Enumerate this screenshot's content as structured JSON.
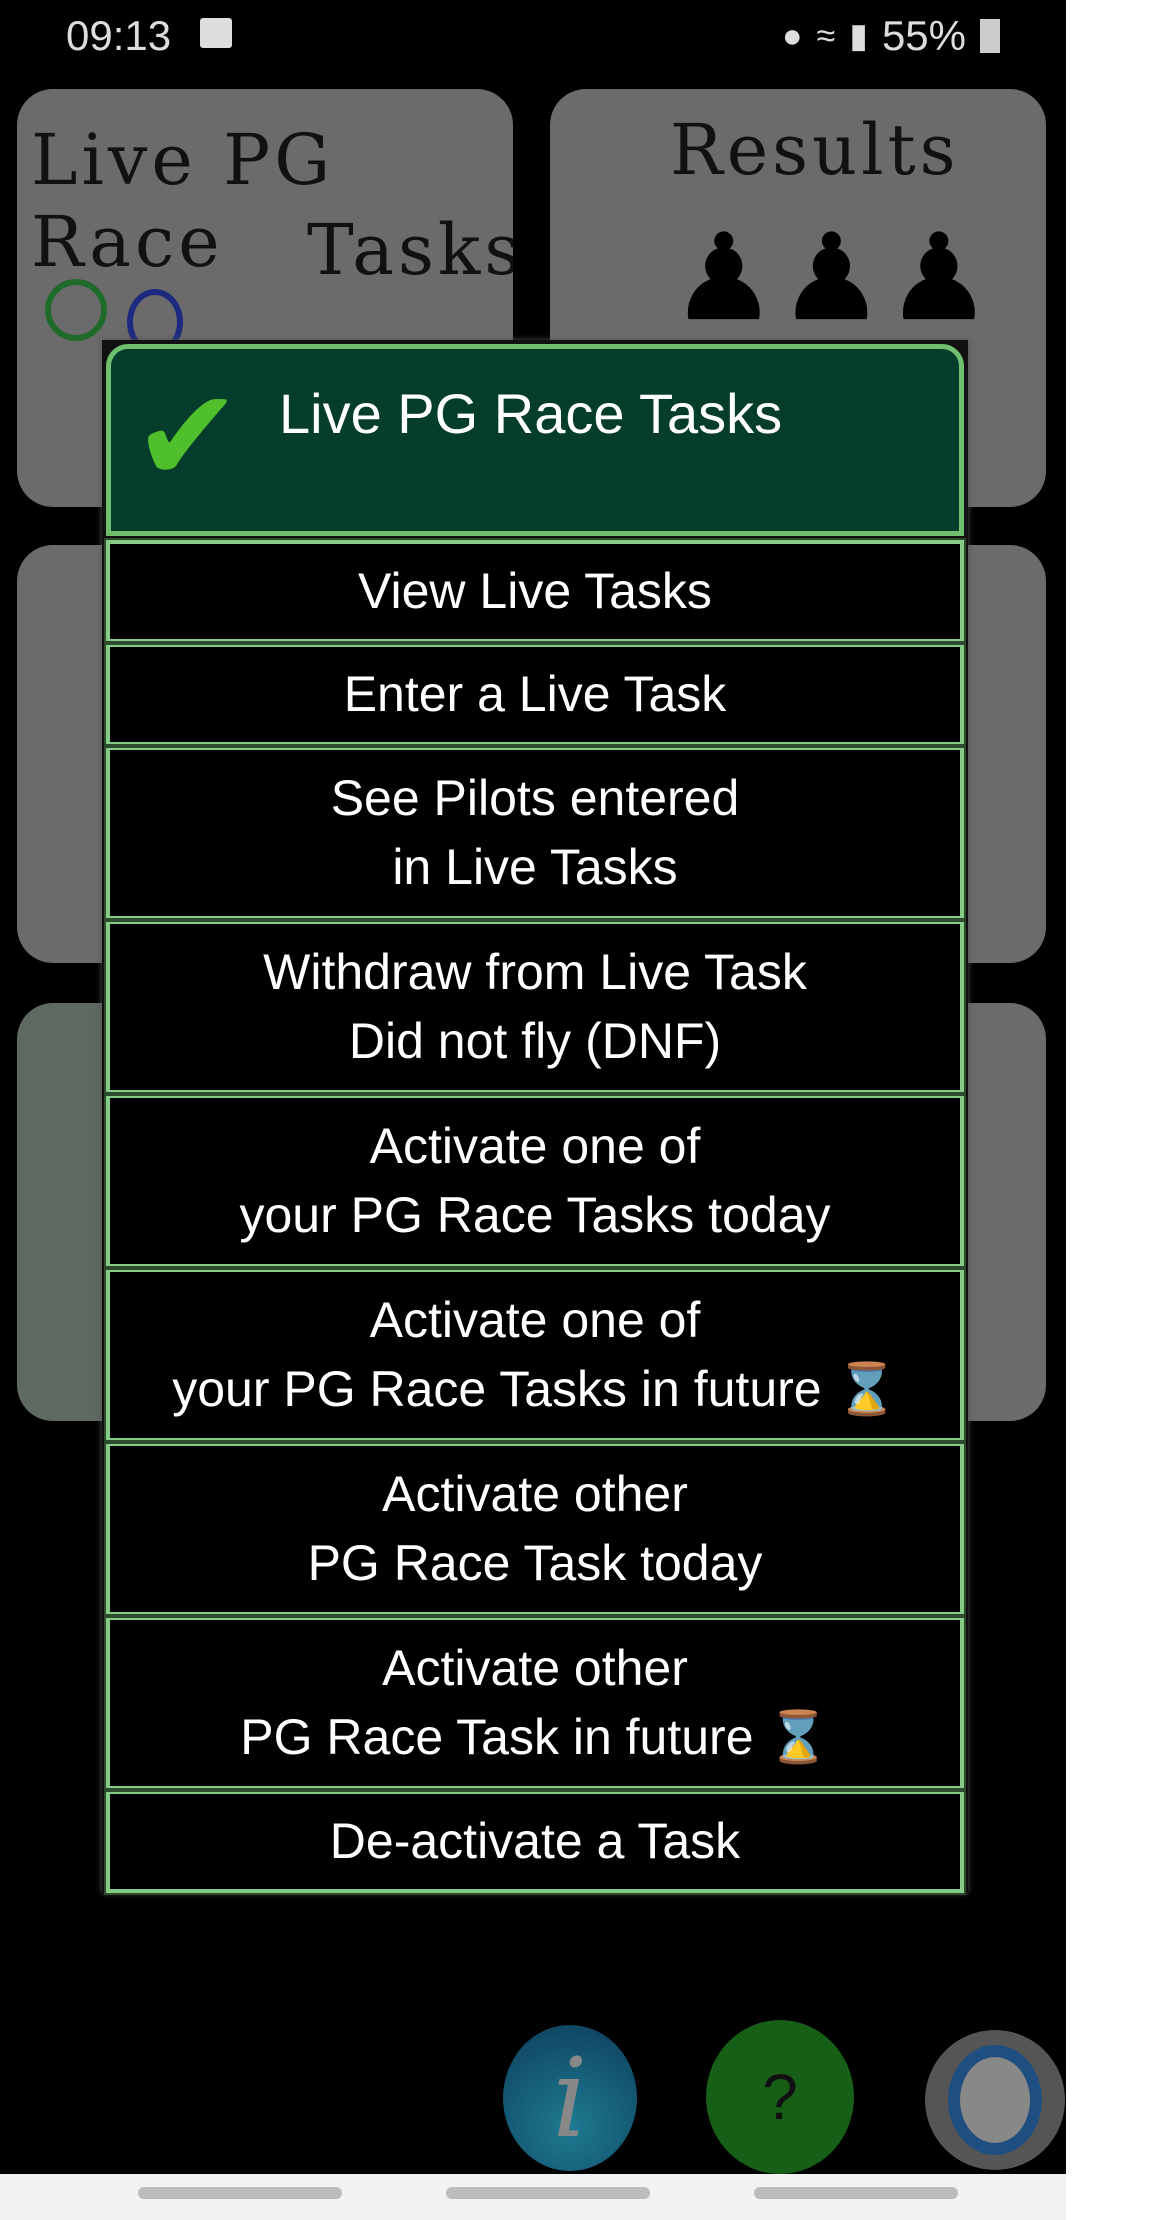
{
  "status_bar": {
    "time": "09:13",
    "battery": "55%",
    "icons": [
      "gallery-icon",
      "location-icon",
      "wifi-icon",
      "signal-icon",
      "battery-charging-icon"
    ]
  },
  "tiles": [
    {
      "title": "Live PG Race Tasks",
      "line1": "Live PG Race",
      "line2": "Tasks"
    },
    {
      "title": "Results"
    }
  ],
  "dialog": {
    "title": "Live PG Race Tasks",
    "accent": "#043d2c",
    "border_color": "#86cc86",
    "items": [
      {
        "line1": "View Live Tasks"
      },
      {
        "line1": "Enter a Live Task"
      },
      {
        "line1": "See Pilots entered",
        "line2": "in Live Tasks"
      },
      {
        "line1": "Withdraw from Live Task",
        "line2": "Did not fly (DNF)"
      },
      {
        "line1": "Activate one of",
        "line2": "your PG Race Tasks today"
      },
      {
        "line1": "Activate one of",
        "line2": "your PG Race Tasks in future",
        "icon": "hourglass-icon"
      },
      {
        "line1": "Activate other",
        "line2": "PG Race Task today"
      },
      {
        "line1": "Activate other",
        "line2": "PG Race Task in future",
        "icon": "hourglass-icon"
      },
      {
        "line1": "De-activate a Task"
      }
    ]
  },
  "bottom": {
    "info": "i",
    "help": "?"
  }
}
